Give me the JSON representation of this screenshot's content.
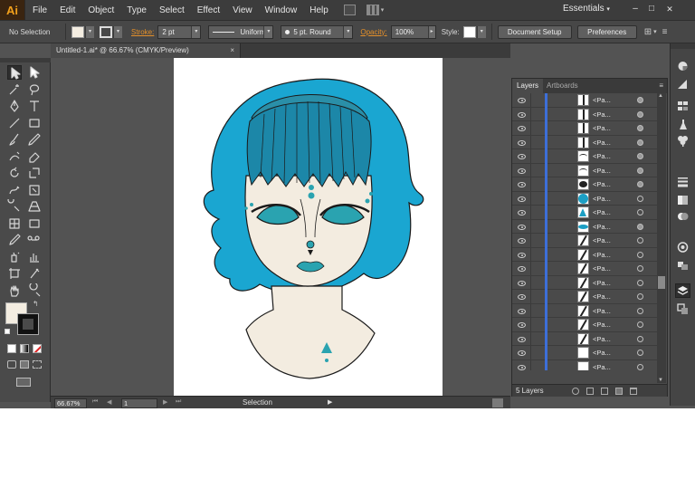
{
  "app": {
    "logo": "Ai",
    "accent": "#f2a01c"
  },
  "menu": [
    "File",
    "Edit",
    "Object",
    "Type",
    "Select",
    "Effect",
    "View",
    "Window",
    "Help"
  ],
  "workspace": {
    "label": "Essentials",
    "caret": "▾"
  },
  "window_controls": [
    "–",
    "□",
    "✕"
  ],
  "control_bar": {
    "selection_label": "No Selection",
    "fill_color": "#f4ede1",
    "stroke_label": "Stroke:",
    "stroke_weight": "2 pt",
    "profile": "Uniform",
    "brush": "5 pt. Round",
    "opacity_label": "Opacity:",
    "opacity_value": "100%",
    "style_label": "Style:",
    "document_setup": "Document Setup",
    "preferences": "Preferences"
  },
  "document": {
    "tab_title": "Untitled-1.ai* @ 66.67% (CMYK/Preview)",
    "close": "×"
  },
  "toolbox": {
    "tools": [
      "selection-tool",
      "direct-selection-tool",
      "magic-wand-tool",
      "lasso-tool",
      "pen-tool",
      "type-tool",
      "line-segment-tool",
      "rectangle-tool",
      "paintbrush-tool",
      "pencil-tool",
      "blob-brush-tool",
      "eraser-tool",
      "rotate-tool",
      "scale-tool",
      "warp-tool",
      "free-transform-tool",
      "shape-builder-tool",
      "perspective-grid-tool",
      "mesh-tool",
      "gradient-tool",
      "eyedropper-tool",
      "blend-tool",
      "symbol-sprayer-tool",
      "column-graph-tool",
      "artboard-tool",
      "slice-tool",
      "hand-tool",
      "zoom-tool"
    ],
    "fill_color": "#f4ede1",
    "stroke_color": "#111111"
  },
  "status_bar": {
    "zoom": "66.67%",
    "artboard": "1",
    "tool": "Selection",
    "arrow": "▶"
  },
  "layers_panel": {
    "tabs": [
      "Layers",
      "Artboards"
    ],
    "menu_icon": "≡",
    "row_label": "<Pa...",
    "thumbnails": [
      "vline",
      "vline",
      "vline",
      "vline",
      "arc",
      "arc",
      "blob",
      "circle-teal",
      "triangle-teal",
      "lips-teal",
      "slash",
      "slash",
      "slash",
      "slash",
      "slash",
      "slash",
      "slash",
      "slash",
      "blank",
      "blank"
    ],
    "targets_filled": [
      true,
      true,
      true,
      true,
      true,
      true,
      true,
      false,
      false,
      true,
      false,
      false,
      false,
      false,
      false,
      false,
      false,
      false,
      false,
      false
    ],
    "footer_count": "5 Layers"
  },
  "artwork": {
    "hair_color": "#1aa6d1",
    "hair_dark": "#1c87a8",
    "skin_color": "#f3ece0",
    "teal": "#2aa3b0",
    "outline": "#1a1a1a"
  },
  "dock": [
    "color-icon",
    "color-guide-icon",
    "swatches-icon",
    "brushes-icon",
    "symbols-icon",
    "stroke-icon",
    "gradient-icon",
    "transparency-icon",
    "appearance-icon",
    "graphic-styles-icon",
    "layers-icon",
    "artboards-icon"
  ]
}
